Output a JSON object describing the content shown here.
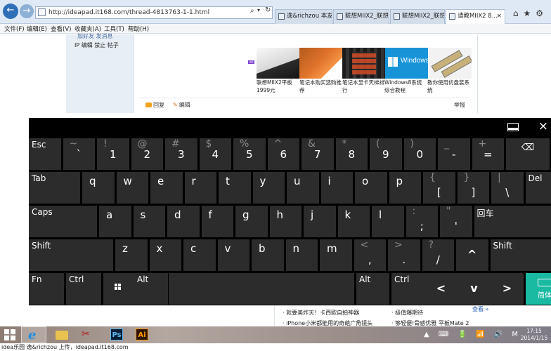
{
  "browser": {
    "address": "http://ideapad.it168.com/thread-4813763-1-1.html",
    "tabs": [
      {
        "label": "逸&richzou 本友会"
      },
      {
        "label": "联想MIIX2_联想..."
      },
      {
        "label": "联想MIIX2_联想..."
      },
      {
        "label": "请教MIIX2 8..."
      }
    ],
    "tab_close": "×",
    "icons": {
      "back": "back-arrow-icon",
      "forward": "forward-arrow-icon",
      "search": "⌕",
      "dropdown": "▾",
      "refresh": "↻",
      "tools": "⌂★⚙"
    }
  },
  "menu": [
    "文件(F)",
    "编辑(E)",
    "查看(V)",
    "收藏夹(A)",
    "工具(T)",
    "帮助(H)"
  ],
  "post": {
    "sidebar_muted": "加好友  发消息",
    "sidebar_links": "IP  编辑  禁止  帖子",
    "thumbnails": [
      {
        "caption": "联想MIIX2平板 1999元"
      },
      {
        "caption": "笔记本购买选购推荐"
      },
      {
        "caption": "笔记本显卡天梯排行"
      },
      {
        "caption": "Windows8系统综合教程"
      },
      {
        "caption": "教你使用优盘装系统"
      }
    ],
    "thumb_text": "Windows",
    "ad_badge": "AD",
    "reply": "回复",
    "edit": "编辑",
    "report": "举报"
  },
  "keyboard": {
    "close": "×",
    "rows": [
      [
        {
          "label": "Esc"
        },
        {
          "shift": "~",
          "char": "`"
        },
        {
          "shift": "!",
          "char": "1"
        },
        {
          "shift": "@",
          "char": "2"
        },
        {
          "shift": "#",
          "char": "3"
        },
        {
          "shift": "$",
          "char": "4"
        },
        {
          "shift": "%",
          "char": "5"
        },
        {
          "shift": "^",
          "char": "6"
        },
        {
          "shift": "&",
          "char": "7"
        },
        {
          "shift": "*",
          "char": "8"
        },
        {
          "shift": "(",
          "char": "9"
        },
        {
          "shift": ")",
          "char": "0"
        },
        {
          "shift": "_",
          "char": "-"
        },
        {
          "shift": "+",
          "char": "="
        },
        {
          "icon": "⌫"
        }
      ],
      [
        {
          "label": "Tab"
        },
        {
          "char": "q"
        },
        {
          "char": "w"
        },
        {
          "char": "e"
        },
        {
          "char": "r"
        },
        {
          "char": "t"
        },
        {
          "char": "y"
        },
        {
          "char": "u"
        },
        {
          "char": "i"
        },
        {
          "char": "o"
        },
        {
          "char": "p"
        },
        {
          "shift": "{",
          "pchar": "["
        },
        {
          "shift": "}",
          "pchar": "]"
        },
        {
          "shift": "|",
          "pchar": "\\"
        },
        {
          "label": "Del"
        }
      ],
      [
        {
          "label": "Caps"
        },
        {
          "char": "a"
        },
        {
          "char": "s"
        },
        {
          "char": "d"
        },
        {
          "char": "f"
        },
        {
          "char": "g"
        },
        {
          "char": "h"
        },
        {
          "char": "j"
        },
        {
          "char": "k"
        },
        {
          "char": "l"
        },
        {
          "shift": ":",
          "pchar": ";"
        },
        {
          "shift": "\"",
          "pchar": "'"
        },
        {
          "label": "回车"
        }
      ],
      [
        {
          "label": "Shift"
        },
        {
          "char": "z"
        },
        {
          "char": "x"
        },
        {
          "char": "c"
        },
        {
          "char": "v"
        },
        {
          "char": "b"
        },
        {
          "char": "n"
        },
        {
          "char": "m"
        },
        {
          "shift": "<",
          "pchar": ","
        },
        {
          "shift": ">",
          "pchar": "."
        },
        {
          "shift": "?",
          "pchar": "/"
        },
        {
          "arrow": "^"
        },
        {
          "label": "Shift"
        }
      ],
      [
        {
          "label": "Fn"
        },
        {
          "label": "Ctrl"
        },
        {
          "icon": "windows"
        },
        {
          "label": "Alt"
        },
        {
          "label": ""
        },
        {
          "label": "Alt"
        },
        {
          "label": "Ctrl"
        },
        {
          "arrow": "<"
        },
        {
          "arrow": "v"
        },
        {
          "arrow": ">"
        },
        {
          "lang": "简体"
        }
      ]
    ]
  },
  "below": {
    "items": [
      "就要美炸天！卡西欧自拍神器",
      "iPhone小米都能用的奇葩广角镜头",
      "极值爆期待",
      "够轻便!骨感优雅 平板Mate 2"
    ],
    "see_more": "查看 »"
  },
  "taskbar": {
    "ps_label": "Ps",
    "ai_label": "Ai",
    "tray": "▲ ⌨ 🔋 📶 🔊 M",
    "time": "17:15",
    "date": "2014/1/15"
  },
  "caption": "idea乐园 逸&richzou 上传，ideapad.it168.com"
}
